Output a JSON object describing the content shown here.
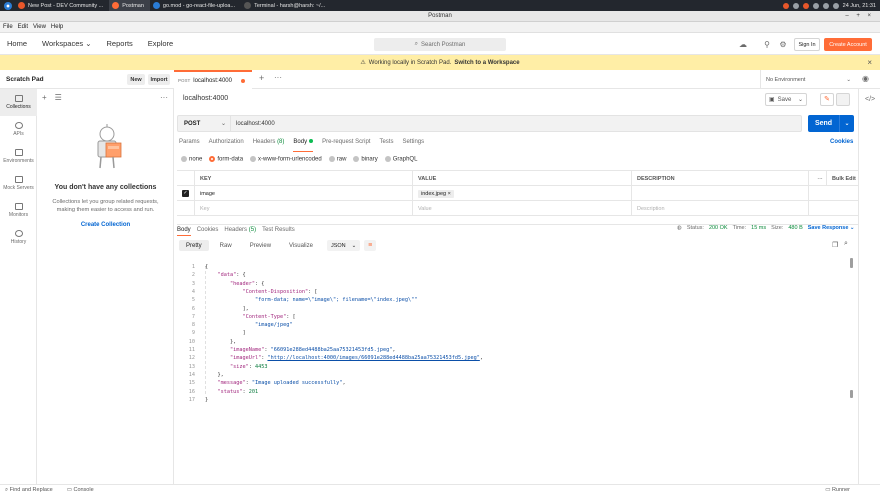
{
  "taskbar": {
    "tasks": [
      {
        "label": "New Post - DEV Community ...",
        "color": "#e8572a",
        "active": false
      },
      {
        "label": "Postman",
        "color": "#ff6c37",
        "active": true
      },
      {
        "label": "go.mod - go-react-file-uploa...",
        "color": "#2a7cd6",
        "active": false
      },
      {
        "label": "Terminal - harsh@harsh: ~/...",
        "color": "#555555",
        "active": false
      }
    ],
    "clock": "24 Jun, 21:31"
  },
  "window": {
    "title": "Postman",
    "controls": "– + ×"
  },
  "menu": [
    "File",
    "Edit",
    "View",
    "Help"
  ],
  "header": {
    "nav": [
      "Home",
      "Workspaces ⌄",
      "Reports",
      "Explore"
    ],
    "search_placeholder": "Search Postman",
    "signin": "Sign In",
    "create_account": "Create Account"
  },
  "banner": {
    "text": "Working locally in Scratch Pad.",
    "link": "Switch to a Workspace"
  },
  "sidebar": {
    "title": "Scratch Pad",
    "new": "New",
    "import": "Import",
    "rail": [
      "Collections",
      "APIs",
      "Environments",
      "Mock Servers",
      "Monitors",
      "History"
    ],
    "empty_title": "You don't have any collections",
    "empty_desc": "Collections let you group related requests, making them easier to access and run.",
    "create": "Create Collection"
  },
  "tab": {
    "method": "POST",
    "label": "localhost:4000"
  },
  "environment": "No Environment",
  "request": {
    "name": "localhost:4000",
    "save": "Save",
    "method": "POST",
    "url": "localhost:4000",
    "send": "Send",
    "tabs": [
      {
        "label": "Params",
        "count": ""
      },
      {
        "label": "Authorization",
        "count": ""
      },
      {
        "label": "Headers",
        "count": "(8)"
      },
      {
        "label": "Body",
        "count": ""
      },
      {
        "label": "Pre-request Script",
        "count": ""
      },
      {
        "label": "Tests",
        "count": ""
      },
      {
        "label": "Settings",
        "count": ""
      }
    ],
    "cookies": "Cookies",
    "body_types": [
      "none",
      "form-data",
      "x-www-form-urlencoded",
      "raw",
      "binary",
      "GraphQL"
    ],
    "form": {
      "headers": [
        "KEY",
        "VALUE",
        "DESCRIPTION"
      ],
      "bulk_edit": "Bulk Edit",
      "rows": [
        {
          "key": "image",
          "value": "index.jpeg",
          "description": ""
        }
      ],
      "placeholders": {
        "key": "Key",
        "value": "Value",
        "description": "Description"
      }
    }
  },
  "response": {
    "tabs": [
      {
        "label": "Body",
        "count": ""
      },
      {
        "label": "Cookies",
        "count": ""
      },
      {
        "label": "Headers",
        "count": "(5)"
      },
      {
        "label": "Test Results",
        "count": ""
      }
    ],
    "status_label": "Status:",
    "status": "200 OK",
    "time_label": "Time:",
    "time": "15 ms",
    "size_label": "Size:",
    "size": "480 B",
    "save_response": "Save Response ⌄",
    "views": [
      "Pretty",
      "Raw",
      "Preview",
      "Visualize"
    ],
    "format": "JSON",
    "code": [
      [
        {
          "c": "p",
          "t": "{"
        }
      ],
      [
        {
          "c": "k",
          "t": "    \"data\""
        },
        {
          "c": "p",
          "t": ": {"
        }
      ],
      [
        {
          "c": "k",
          "t": "        \"header\""
        },
        {
          "c": "p",
          "t": ": {"
        }
      ],
      [
        {
          "c": "k",
          "t": "            \"Content-Disposition\""
        },
        {
          "c": "p",
          "t": ": ["
        }
      ],
      [
        {
          "c": "s",
          "t": "                \"form-data; name=\\\"image\\\"; filename=\\\"index.jpeg\\\"\""
        }
      ],
      [
        {
          "c": "p",
          "t": "            ],"
        }
      ],
      [
        {
          "c": "k",
          "t": "            \"Content-Type\""
        },
        {
          "c": "p",
          "t": ": ["
        }
      ],
      [
        {
          "c": "s",
          "t": "                \"image/jpeg\""
        }
      ],
      [
        {
          "c": "p",
          "t": "            ]"
        }
      ],
      [
        {
          "c": "p",
          "t": "        },"
        }
      ],
      [
        {
          "c": "k",
          "t": "        \"imageName\""
        },
        {
          "c": "p",
          "t": ": "
        },
        {
          "c": "s",
          "t": "\"66091e288ed4488ba25aa75321453fd5.jpeg\""
        },
        {
          "c": "p",
          "t": ","
        }
      ],
      [
        {
          "c": "k",
          "t": "        \"imageUrl\""
        },
        {
          "c": "p",
          "t": ": "
        },
        {
          "c": "u",
          "t": "\"http://localhost:4000/images/66091e288ed4488ba25aa75321453fd5.jpeg\""
        },
        {
          "c": "p",
          "t": ","
        }
      ],
      [
        {
          "c": "k",
          "t": "        \"size\""
        },
        {
          "c": "p",
          "t": ": "
        },
        {
          "c": "n",
          "t": "4453"
        }
      ],
      [
        {
          "c": "p",
          "t": "    },"
        }
      ],
      [
        {
          "c": "k",
          "t": "    \"message\""
        },
        {
          "c": "p",
          "t": ": "
        },
        {
          "c": "s",
          "t": "\"Image uploaded successfully\""
        },
        {
          "c": "p",
          "t": ","
        }
      ],
      [
        {
          "c": "k",
          "t": "    \"status\""
        },
        {
          "c": "p",
          "t": ": "
        },
        {
          "c": "n",
          "t": "201"
        }
      ],
      [
        {
          "c": "p",
          "t": "}"
        }
      ]
    ]
  },
  "statusbar": {
    "find": "Find and Replace",
    "console": "Console",
    "runner": "Runner"
  },
  "colors": {
    "accent": "#ff6c37",
    "primary": "#0265d2",
    "banner": "#ffeea6",
    "success": "#0a8a3a"
  }
}
